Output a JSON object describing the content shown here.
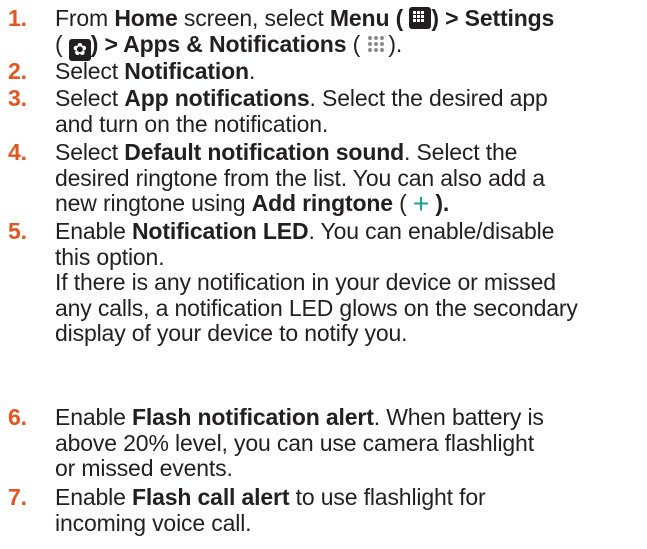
{
  "steps": [
    {
      "number": "1.",
      "text": [
        "From ",
        "Home",
        " screen, select ",
        "Menu",
        " ( ",
        ") > Settings",
        "( ",
        ") > Apps & Notifications",
        " ( ",
        ")."
      ]
    },
    {
      "number": "2.",
      "text": [
        "Select ",
        "Notification",
        "."
      ]
    },
    {
      "number": "3.",
      "text": [
        "Select ",
        "App notifications",
        ". Select the desired app",
        "and turn on the notification."
      ]
    },
    {
      "number": "4.",
      "text": [
        "Select ",
        "Default notification sound",
        ". Select the",
        "desired ringtone from the list. You can also add a",
        "new ringtone using ",
        "Add ringtone",
        " ( ",
        " )."
      ]
    },
    {
      "number": "5.",
      "text": [
        "Enable ",
        "Notification LED",
        ". You can enable/disable",
        "this option.",
        "If there is any notification in your device or missed",
        "any calls, a notification LED glows on the secondary",
        "display of your device to notify you."
      ]
    },
    {
      "number": "6.",
      "text": [
        "Enable ",
        "Flash notification alert",
        ". When battery is",
        "above 20% level, you can use camera flashlight",
        "or missed events."
      ]
    },
    {
      "number": "7.",
      "text": [
        "Enable ",
        "Flash call alert",
        " to use flashlight for",
        "incoming voice call."
      ]
    }
  ],
  "icons": {
    "menu": "menu-grid-icon",
    "settings": "gear-icon",
    "apps": "apps-dots-icon",
    "add": "plus-icon",
    "plus_glyph": "+",
    "gear_glyph": "✿"
  },
  "colors": {
    "step_number": "#e5551f",
    "text": "#231f20",
    "plus": "#1aa196"
  }
}
